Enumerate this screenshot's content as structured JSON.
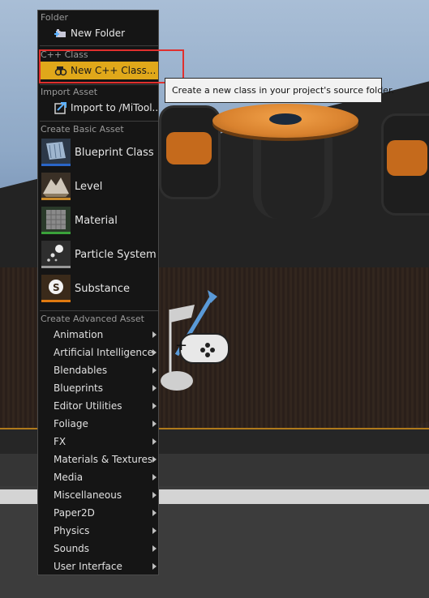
{
  "menu": {
    "folder_header": "Folder",
    "new_folder": {
      "label": "New Folder",
      "icon": "new-folder-icon"
    },
    "cpp_header": "C++ Class",
    "new_cpp_class": {
      "label": "New C++ Class...",
      "icon": "cpp-class-icon",
      "highlight_color": "#e0a81a"
    },
    "import_header": "Import Asset",
    "import_to": {
      "label": "Import to /MiTool...",
      "icon": "import-icon"
    },
    "basic_header": "Create Basic Asset",
    "basic_assets": [
      {
        "label": "Blueprint Class",
        "icon": "blueprint-class-icon",
        "accent": "#2a66c8"
      },
      {
        "label": "Level",
        "icon": "level-icon",
        "accent": "#c98a2a"
      },
      {
        "label": "Material",
        "icon": "material-icon",
        "accent": "#3aa23a"
      },
      {
        "label": "Particle System",
        "icon": "particle-system-icon",
        "accent": "#9a9a9a"
      },
      {
        "label": "Substance",
        "icon": "substance-icon",
        "accent": "#e07a10"
      }
    ],
    "advanced_header": "Create Advanced Asset",
    "advanced_assets": [
      "Animation",
      "Artificial Intelligence",
      "Blendables",
      "Blueprints",
      "Editor Utilities",
      "Foliage",
      "FX",
      "Materials & Textures",
      "Media",
      "Miscellaneous",
      "Paper2D",
      "Physics",
      "Sounds",
      "User Interface"
    ]
  },
  "tooltip": {
    "text": "Create a new class in your project's source folder."
  },
  "colors": {
    "menu_bg": "#151515",
    "highlight": "#e0a81a",
    "annotation_box": "#e0302e"
  }
}
